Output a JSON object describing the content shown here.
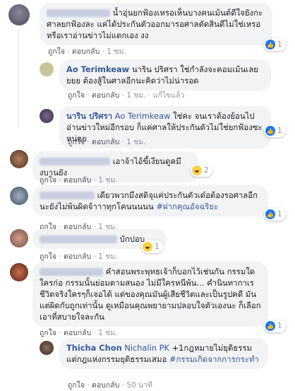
{
  "comments": [
    {
      "name": "Thiti Wongsa",
      "text": "น้ำอุ่นยกฟ้องเหรอเห็นบางคนเม้นต์ดีใจยังกะศาลยกฟ้องละ แค่ได้ประกันตัวออกมารอศาลตัดสินดีไม่ใช่เหรอ หรือเราอ่านข่าวไม่แตกเอง งง",
      "like": "ถูกใจ",
      "reply": "ตอบกลับ",
      "time": "1 ชม.",
      "reaction_count": "1"
    },
    {
      "name": "Ao Terimkeaw",
      "text": "นาริน ปริศรา ใช่กำลังจะคอมเม้นเลยยยย ต้องสู้ในศาลอีกนะคิดว่าไม่น่ารอด",
      "like": "ถูกใจ",
      "reply": "ตอบกลับ",
      "time": "1 ชม.",
      "edited": "แก้ไขแล้ว"
    },
    {
      "name": "นาริน ปริศรา",
      "mention": "Ao Terimkeaw",
      "text": "ใช่คะ จนเราต้องย้อนไปอ่านข่าวใหม่อีกรอบ ก็แค่ศาลให้ประกันตัวไม่ใช่ยกฟ้องซะหน่อย",
      "like": "ถูกใจ",
      "reply": "ตอบกลับ",
      "time": "1 ชม.",
      "reaction_count": "1"
    },
    {
      "name": "Pai Wong Nim",
      "text": "เอาจ้าไอ้ขี้เงียนดูคมึงบานยัง",
      "like": "ถูกใจ",
      "reply": "ตอบกลับ",
      "time": "1 ชม.",
      "reaction_count": "2"
    },
    {
      "name": "Ao Terimkeaw",
      "text": "เดียวพวกมึงสติจุแค่ประกันตัวเด๋อต้องรอศาลอีกนะยังไม่พ้นผิดจ้าาาทุกโคนนนนน",
      "hashtag": "#ฝากคุณอัจฉริยะ",
      "like": "ถูกใจ",
      "reply": "ตอบกลับ",
      "time": "1 ชม.",
      "reaction_count": "1"
    },
    {
      "name": "Kanokwan Suwannaly",
      "text": "บักปอบ",
      "like": "ถูกใจ",
      "reply": "ตอบกลับ",
      "time": "1 ชม.",
      "reaction_count": "1"
    },
    {
      "name": "Wirat Pornchai",
      "text": "คำสอนพระพุทธเจ้าก็บอกไว้เช่นกัน กรรมใดใครก่อ กรรมนั้นย่อมตามสนอง ไม่มีใครหนีพ้น... คำนินทากาเร ชีวิตจริงใครๆก็เจอได้ แต่ของคุณมันผู้เสียชีวิตและเป็นรูปคดี มันแต่ผิดกับถูกเท่านั้น ดูเหมือนคุณพยายามปลอบใจตัวเองนะ ก็เลือกเอาที่สบายใจละกัน",
      "like": "ถูกใจ",
      "reply": "ตอบกลับ",
      "time": "1 ชม.",
      "reaction_count": "1"
    },
    {
      "name": "Thicha Chon",
      "mention": "Nichalin PK",
      "text": "+1กฎหมายไม่ยุติธรรมแต่กฎแห่งกรรมยุติธรรมเสมอ",
      "hashtag": "#กรรมเกิดจากการกระทำ",
      "like": "ถูกใจ",
      "reply": "ตอบกลับ",
      "time": "50 นาที"
    }
  ]
}
